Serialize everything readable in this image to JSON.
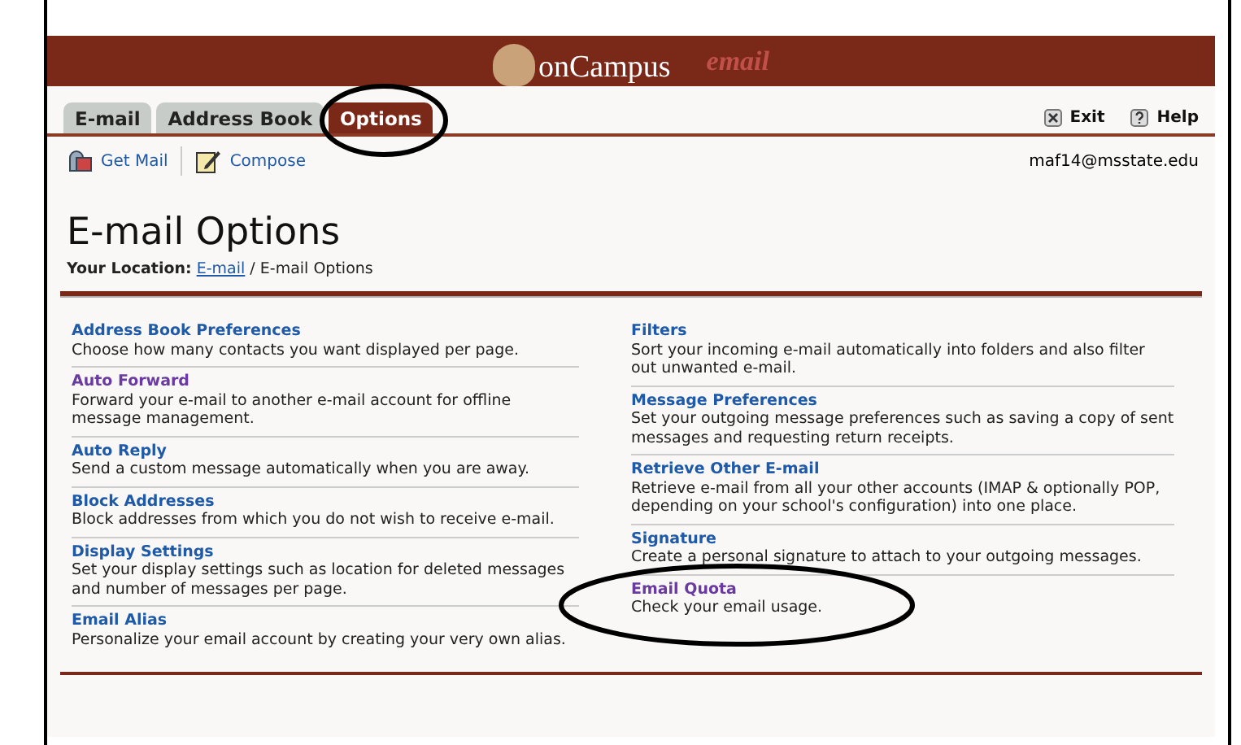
{
  "header": {
    "logo_text": "onCampus",
    "logo_suffix": "email"
  },
  "tabs": [
    {
      "label": "E-mail",
      "selected": false,
      "circled": false
    },
    {
      "label": "Address Book",
      "selected": false,
      "circled": false
    },
    {
      "label": "Options",
      "selected": true,
      "circled": true
    }
  ],
  "top_links": [
    {
      "label": "Exit",
      "kind": "exit"
    },
    {
      "label": "Help",
      "kind": "help"
    }
  ],
  "toolbar": [
    {
      "label": "Get Mail",
      "kind": "mailbox"
    },
    {
      "label": "Compose",
      "kind": "compose"
    }
  ],
  "user_email": "maf14@msstate.edu",
  "page_title": "E-mail Options",
  "breadcrumb": {
    "label": "Your Location:",
    "link": "E-mail",
    "rest": "/ E-mail Options"
  },
  "columns": [
    [
      {
        "title": "Address Book Preferences",
        "description": "Choose how many contacts you want displayed per page.",
        "visited": false,
        "circled": false
      },
      {
        "title": "Auto Forward",
        "description": "Forward your e-mail to another e-mail account for offline message management.",
        "visited": true,
        "circled": false
      },
      {
        "title": "Auto Reply",
        "description": "Send a custom message automatically when you are away.",
        "visited": false,
        "circled": false
      },
      {
        "title": "Block Addresses",
        "description": "Block addresses from which you do not wish to receive e-mail.",
        "visited": false,
        "circled": false
      },
      {
        "title": "Display Settings",
        "description": "Set your display settings such as location for deleted messages and number of messages per page.",
        "visited": false,
        "circled": false
      },
      {
        "title": "Email Alias",
        "description": "Personalize your email account by creating your very own alias.",
        "visited": false,
        "circled": false
      }
    ],
    [
      {
        "title": "Filters",
        "description": "Sort your incoming e-mail automatically into folders and also filter out unwanted e-mail.",
        "visited": false,
        "circled": false
      },
      {
        "title": "Message Preferences",
        "description": "Set your outgoing message preferences such as saving a copy of sent messages and requesting return receipts.",
        "visited": false,
        "circled": false
      },
      {
        "title": "Retrieve Other E-mail",
        "description": "Retrieve e-mail from all your other accounts (IMAP & optionally POP, depending on your school's configuration) into one place.",
        "visited": false,
        "circled": false
      },
      {
        "title": "Signature",
        "description": "Create a personal signature to attach to your outgoing messages.",
        "visited": false,
        "circled": false
      },
      {
        "title": "Email Quota",
        "description": "Check your email usage.",
        "visited": true,
        "circled": true
      }
    ]
  ]
}
